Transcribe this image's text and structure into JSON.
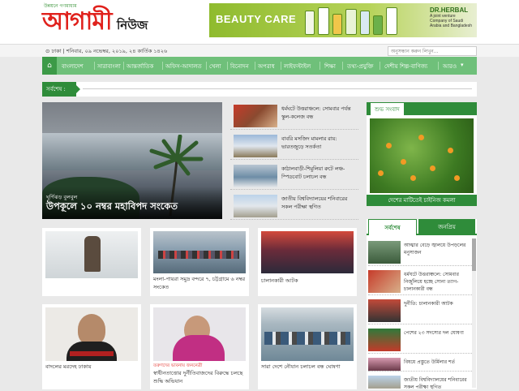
{
  "header": {
    "tagline": "উন্নয়নে গণমাধ্যম",
    "logo_main": "আগামী",
    "logo_sub": "নিউজ",
    "ad": {
      "title": "BEAUTY CARE",
      "brand": "DR.HERBAL",
      "brand_sub": "A joint venture Company of Saudi Arabia and Bangladesh"
    }
  },
  "datebar": {
    "date": "⊙ ঢাকা | শনিবার, ০৯ নভেম্বর, ২০১৯, ২৪ কার্তিক ১৪২৬",
    "search_placeholder": "অনুসন্ধান করুন লিখুন..."
  },
  "nav": {
    "home_icon": "home-icon",
    "items": [
      "বাংলাদেশ",
      "সারাবাংলা",
      "আন্তর্জাতিক",
      "অফিস-আদালত",
      "খেলা",
      "বিনোদন",
      "অপরাধ",
      "লাইফস্টাইল",
      "শিক্ষা",
      "তথ্য-প্রযুক্তি",
      "দেশীয় শিল্প-বাণিজ্য",
      "আরও"
    ]
  },
  "ticker": {
    "label": "সর্বশেষ :"
  },
  "lead": {
    "kicker": "ঘূর্ণিঝড় বুলবুল",
    "headline": "উপকূলে ১০ নম্বর মহাবিপদ সংকেত"
  },
  "side_news": [
    {
      "text": "ধর্মঘটে উত্তরাঞ্চলে: সোমবার পর্যন্ত স্কুল-কলেজ বন্ধ"
    },
    {
      "text": "বাবরি মসজিদ মামলার রায়: ভারতজুড়ে সতর্কতা"
    },
    {
      "text": "কাঠালবাড়ী-শিমুলিয়া রুটে লঞ্চ-স্পিডবোট চলাচল বন্ধ"
    },
    {
      "text": "জাতীয় বিশ্ববিদ্যালয়ের শনিবারের সকল পরীক্ষা স্থগিত"
    }
  ],
  "shubho": {
    "header": "শুভ সংবাদ",
    "caption": "দেশের মাটিতেই চাইনিজ কমলা"
  },
  "cards_row1": [
    {
      "caption": ""
    },
    {
      "caption": "মংলা-পায়রা সমুদ্র বন্দরে ৭, চট্টগ্রামে ৬ নম্বর সংকেত"
    },
    {
      "caption": "চালানকারী আটক"
    }
  ],
  "cards_row2": [
    {
      "kicker": "",
      "caption": "বাদলের মরদেহ ঢাকায়"
    },
    {
      "kicker": "তরুণদের ভাবনায় জননেত্রী",
      "caption": "স্বাধীনতাত্তোর দুর্নীতিবাজদের বিরুদ্ধে চলছে শুদ্ধি অভিযান"
    },
    {
      "kicker": "",
      "caption": "সারা দেশে নৌযান চলাচল বন্ধ ঘোষণা"
    }
  ],
  "tabs": {
    "tab_latest": "সর্বশেষ",
    "tab_popular": "জনপ্রিয়",
    "items": [
      {
        "text": "আত্মার বেড়ে জ্বালয়ে উপড়লের মনুসাজন"
      },
      {
        "text": "ধর্মঘটে উত্তরাঞ্চলে: সোমবার নির্জুলিয়ে হচ্ছে সোনা ত্যাগ-চালানকারী বন্ধ"
      },
      {
        "text": "দুর্নীতি: চালানকারী আটক"
      },
      {
        "text": "পেশের ২৩ সদস্যের দল ঘোষণা"
      },
      {
        "text": "বিষয়ে প্রস্তুতে উর্মিলার শর্ত"
      },
      {
        "text": "জাতীয় বিশ্ববিদ্যালয়ের শনিবারের সকল পরীক্ষা স্থগিত"
      }
    ]
  },
  "colors": {
    "brand_green": "#2f8c3a",
    "nav_green": "#6fc07a",
    "logo_red": "#e0211c"
  }
}
